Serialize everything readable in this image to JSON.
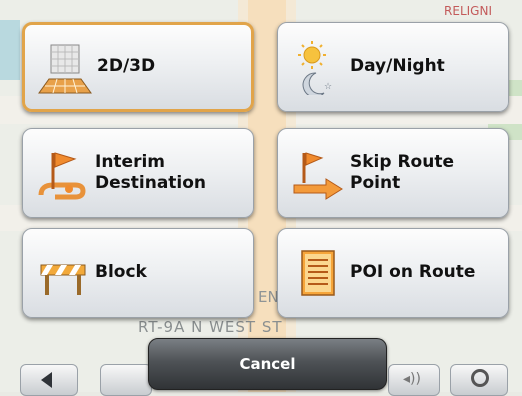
{
  "menu": {
    "items": [
      {
        "id": "2d3d",
        "label": "2D/3D",
        "icon": "perspective-icon",
        "selected": true
      },
      {
        "id": "day-night",
        "label": "Day/Night",
        "icon": "sun-moon-icon",
        "selected": false
      },
      {
        "id": "interim",
        "label": "Interim\nDestination",
        "icon": "interim-flag-icon",
        "selected": false
      },
      {
        "id": "skip",
        "label": "Skip Route\nPoint",
        "icon": "skip-route-icon",
        "selected": false
      },
      {
        "id": "block",
        "label": "Block",
        "icon": "roadblock-icon",
        "selected": false
      },
      {
        "id": "poi",
        "label": "POI on Route",
        "icon": "poi-list-icon",
        "selected": false
      }
    ]
  },
  "cancel_label": "Cancel",
  "map": {
    "street_label": "RT-9A N WEST ST",
    "street_partial": "EN",
    "top_label": "RELIGNI"
  },
  "colors": {
    "selected_border": "#e1a44a",
    "cancel_bg": "#4e5256"
  }
}
